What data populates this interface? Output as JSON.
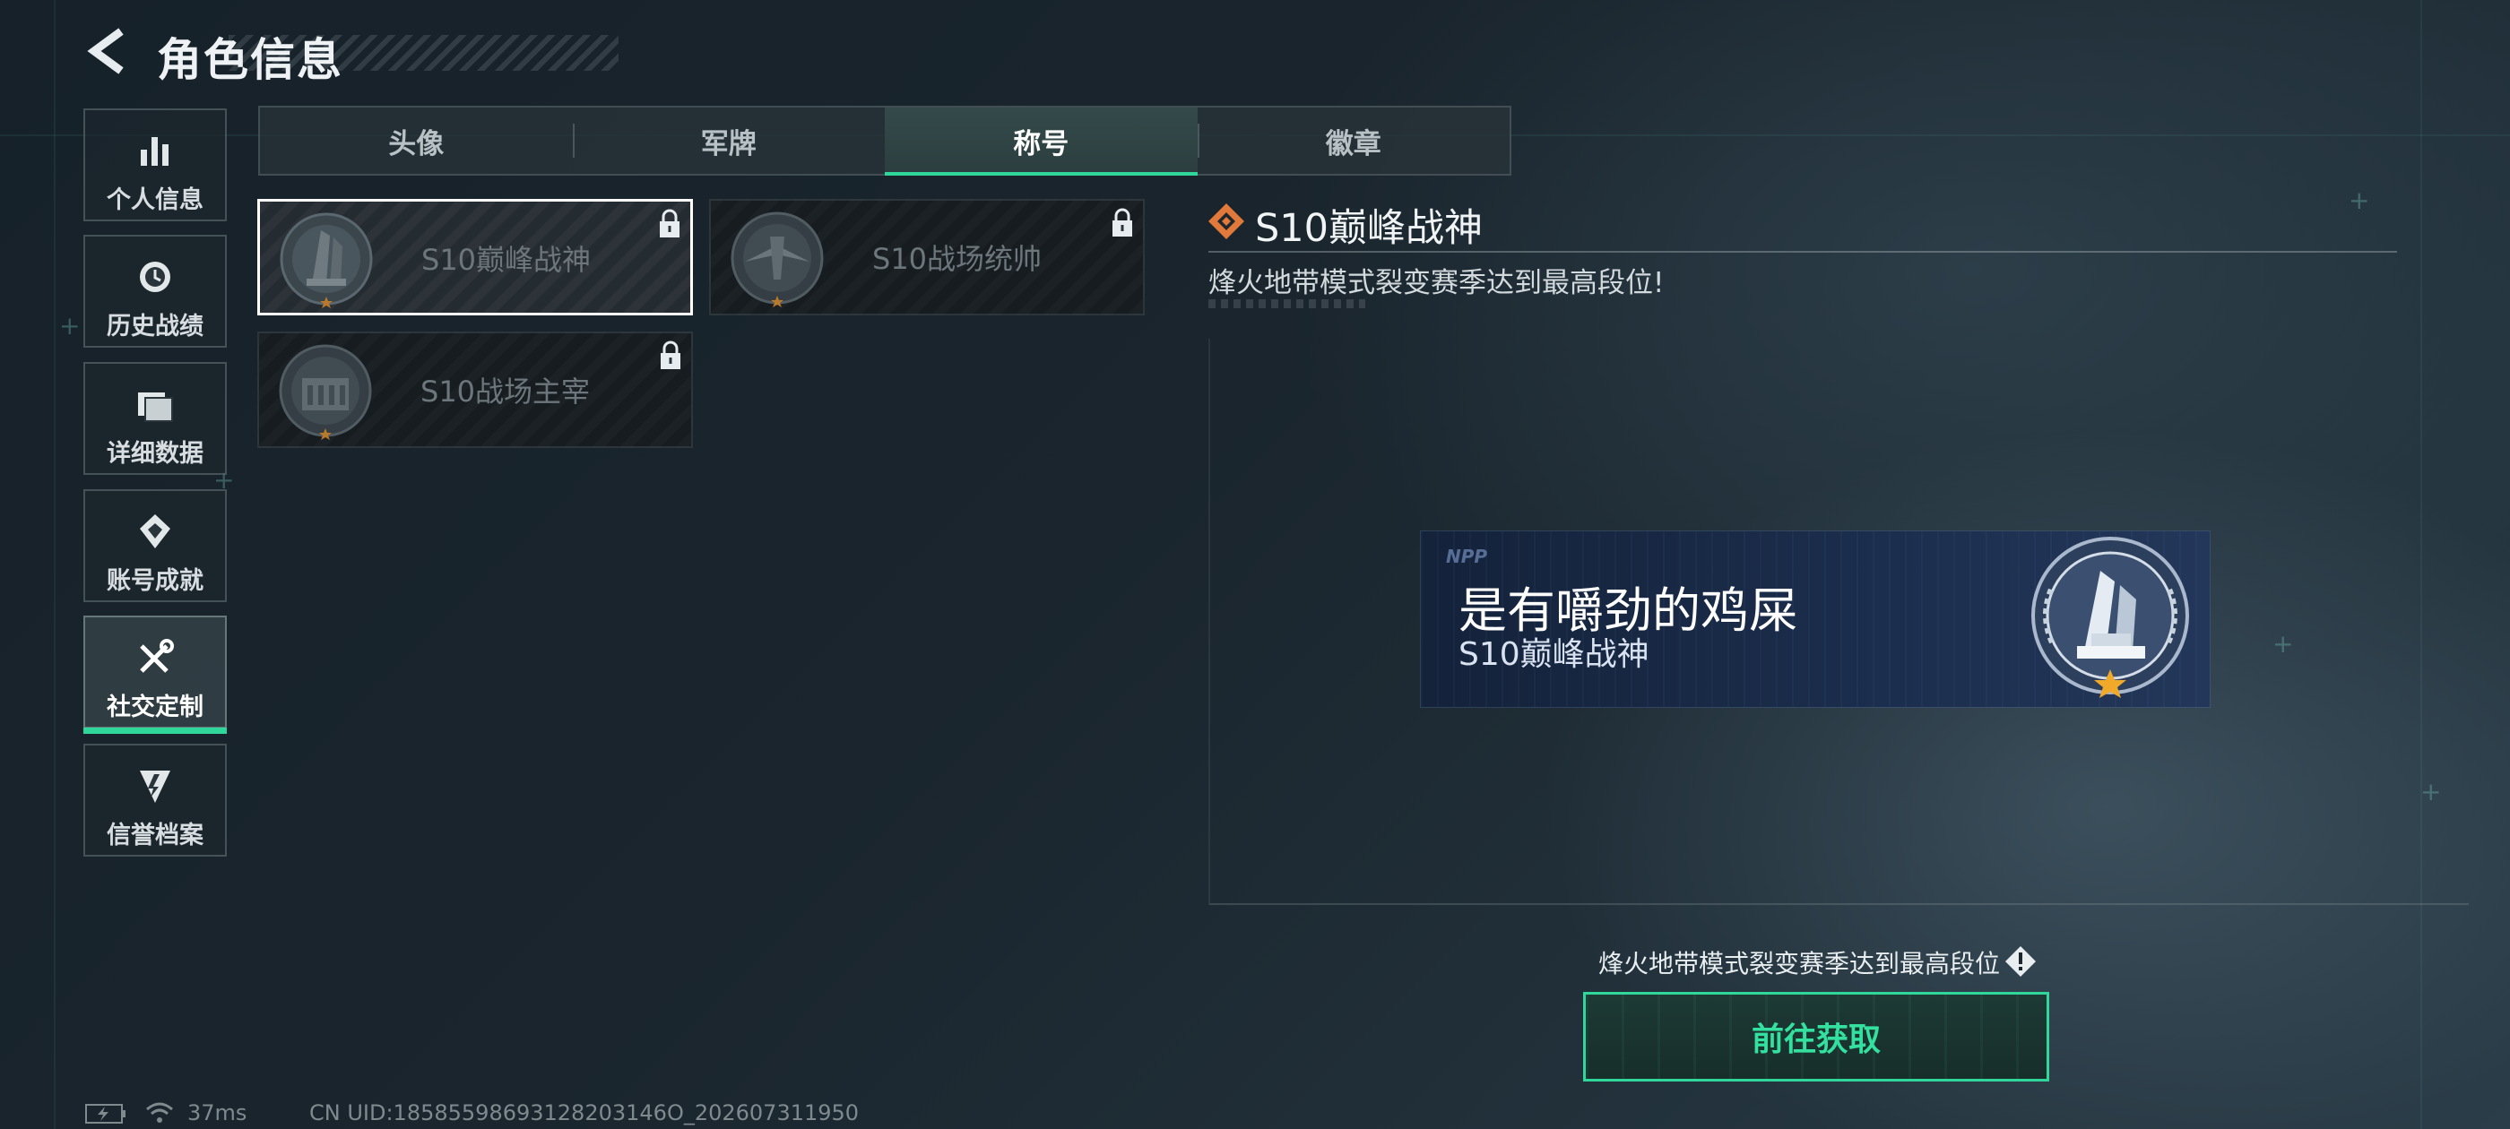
{
  "header": {
    "title": "角色信息"
  },
  "sidebar": {
    "items": [
      {
        "label": "个人信息",
        "icon": "bar-chart-icon"
      },
      {
        "label": "历史战绩",
        "icon": "history-icon"
      },
      {
        "label": "详细数据",
        "icon": "data-folder-icon"
      },
      {
        "label": "账号成就",
        "icon": "achievement-icon"
      },
      {
        "label": "社交定制",
        "icon": "tools-icon",
        "active": true
      },
      {
        "label": "信誉档案",
        "icon": "credit-shield-icon"
      }
    ]
  },
  "tabs": [
    {
      "label": "头像"
    },
    {
      "label": "军牌"
    },
    {
      "label": "称号",
      "active": true
    },
    {
      "label": "徽章"
    }
  ],
  "titles": [
    {
      "name": "S10巅峰战神",
      "locked": true,
      "selected": true,
      "emblem": "peak-god-emblem-icon"
    },
    {
      "name": "S10战场统帅",
      "locked": true,
      "selected": false,
      "emblem": "commander-emblem-icon"
    },
    {
      "name": "S10战场主宰",
      "locked": true,
      "selected": false,
      "emblem": "dominator-emblem-icon"
    }
  ],
  "detail": {
    "title": "S10巅峰战神",
    "description": "烽火地带模式裂变赛季达到最高段位!"
  },
  "nameplate": {
    "logo": "NPP",
    "player_name": "是有嚼劲的鸡屎",
    "title": "S10巅峰战神"
  },
  "requirement": {
    "text": "烽火地带模式裂变赛季达到最高段位"
  },
  "action": {
    "label": "前往获取"
  },
  "status_bar": {
    "ping": "37ms",
    "uid": "CN UID:18585598693128203146O_202607311950"
  },
  "colors": {
    "accent": "#2fd79a",
    "detail_icon": "#e0793a",
    "star": "#f0a928"
  }
}
